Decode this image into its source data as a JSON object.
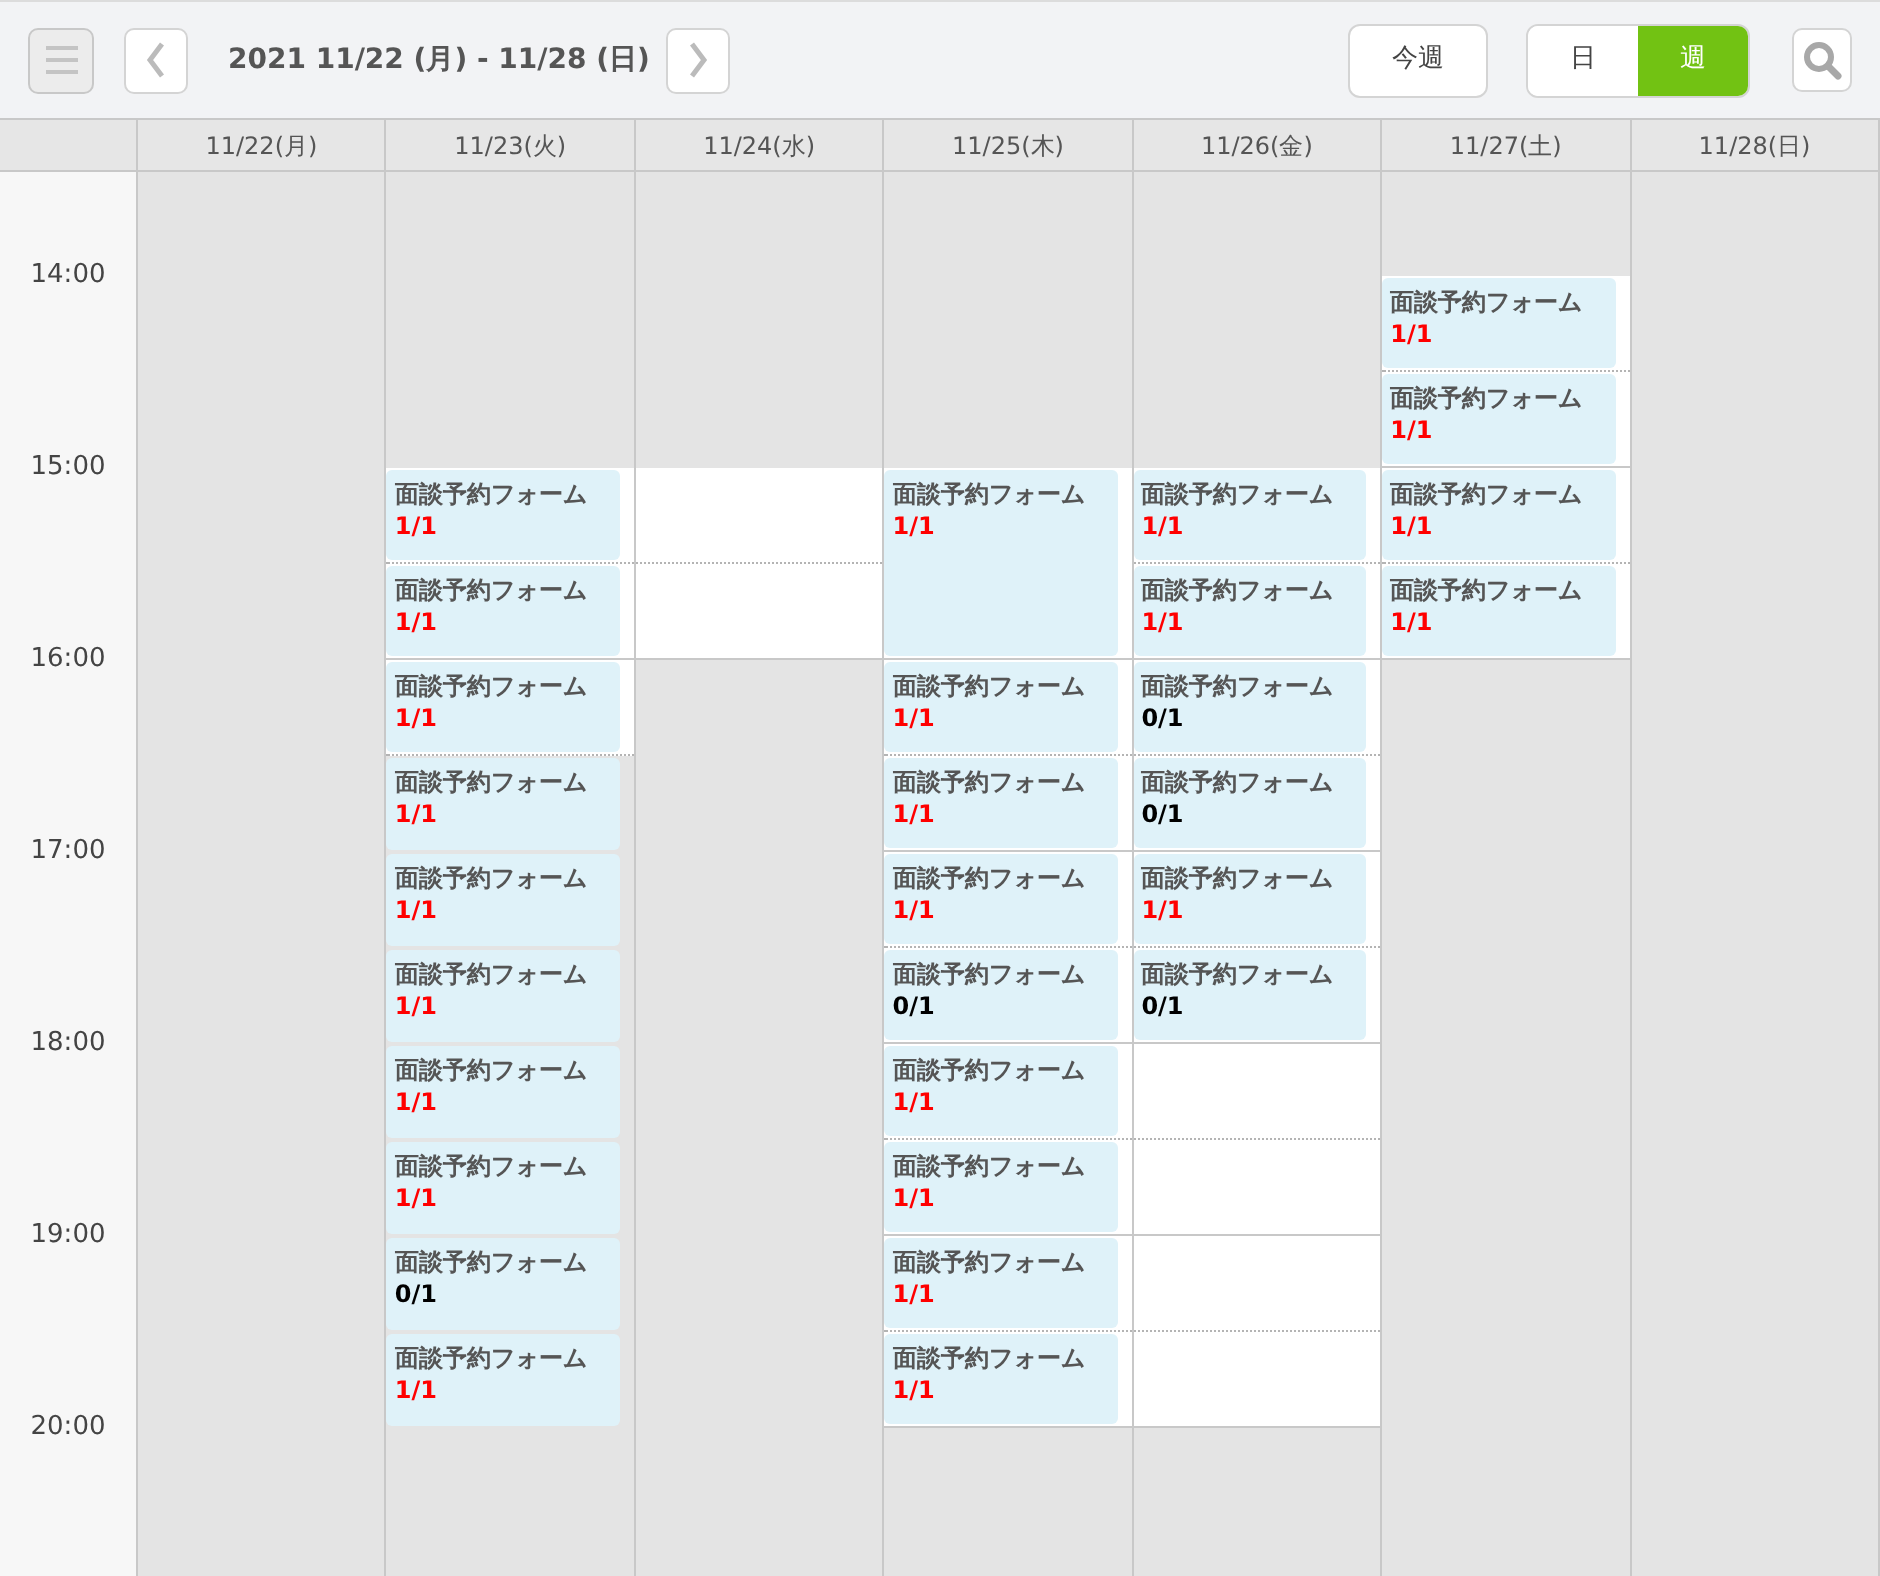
{
  "toolbar": {
    "date_range": "2021 11/22 (月) - 11/28 (日)",
    "today_button": "今週",
    "views": [
      {
        "label": "日",
        "selected": false
      },
      {
        "label": "週",
        "selected": true
      }
    ]
  },
  "times": [
    "14:00",
    "15:00",
    "16:00",
    "17:00",
    "18:00",
    "19:00",
    "20:00"
  ],
  "days": [
    {
      "label": "11/22(月)",
      "slots": [
        {
          "kind": "closed"
        },
        {
          "kind": "closed"
        },
        {
          "kind": "closed"
        },
        {
          "kind": "closed"
        },
        {
          "kind": "closed"
        },
        {
          "kind": "closed"
        },
        {
          "kind": "closed"
        },
        {
          "kind": "closed"
        },
        {
          "kind": "closed"
        },
        {
          "kind": "closed"
        },
        {
          "kind": "closed"
        },
        {
          "kind": "closed"
        },
        {
          "kind": "closed"
        },
        {
          "kind": "closed"
        }
      ]
    },
    {
      "label": "11/23(火)",
      "slots": [
        {
          "kind": "closed"
        },
        {
          "kind": "closed"
        },
        {
          "kind": "event",
          "open": true,
          "title": "面談予約フォーム",
          "count": "1/1",
          "full": true
        },
        {
          "kind": "event",
          "open": true,
          "title": "面談予約フォーム",
          "count": "1/1",
          "full": true
        },
        {
          "kind": "event",
          "open": true,
          "title": "面談予約フォーム",
          "count": "1/1",
          "full": true
        },
        {
          "kind": "event",
          "open": false,
          "title": "面談予約フォーム",
          "count": "1/1",
          "full": true
        },
        {
          "kind": "event",
          "open": false,
          "title": "面談予約フォーム",
          "count": "1/1",
          "full": true
        },
        {
          "kind": "event",
          "open": false,
          "title": "面談予約フォーム",
          "count": "1/1",
          "full": true
        },
        {
          "kind": "event",
          "open": false,
          "title": "面談予約フォーム",
          "count": "1/1",
          "full": true
        },
        {
          "kind": "event",
          "open": false,
          "title": "面談予約フォーム",
          "count": "1/1",
          "full": true
        },
        {
          "kind": "event",
          "open": false,
          "title": "面談予約フォーム",
          "count": "0/1",
          "full": false
        },
        {
          "kind": "event",
          "open": false,
          "title": "面談予約フォーム",
          "count": "1/1",
          "full": true
        },
        {
          "kind": "closed"
        },
        {
          "kind": "closed"
        }
      ]
    },
    {
      "label": "11/24(水)",
      "slots": [
        {
          "kind": "closed"
        },
        {
          "kind": "closed"
        },
        {
          "kind": "open"
        },
        {
          "kind": "open"
        },
        {
          "kind": "closed"
        },
        {
          "kind": "closed"
        },
        {
          "kind": "closed"
        },
        {
          "kind": "closed"
        },
        {
          "kind": "closed"
        },
        {
          "kind": "closed"
        },
        {
          "kind": "closed"
        },
        {
          "kind": "closed"
        },
        {
          "kind": "closed"
        },
        {
          "kind": "closed"
        }
      ]
    },
    {
      "label": "11/25(木)",
      "slots": [
        {
          "kind": "closed"
        },
        {
          "kind": "closed"
        },
        {
          "kind": "event",
          "open": true,
          "title": "面談予約フォーム",
          "count": "1/1",
          "full": true
        },
        {
          "kind": "continued"
        },
        {
          "kind": "event",
          "open": true,
          "title": "面談予約フォーム",
          "count": "1/1",
          "full": true
        },
        {
          "kind": "event",
          "open": true,
          "title": "面談予約フォーム",
          "count": "1/1",
          "full": true
        },
        {
          "kind": "event",
          "open": true,
          "title": "面談予約フォーム",
          "count": "1/1",
          "full": true
        },
        {
          "kind": "event",
          "open": true,
          "title": "面談予約フォーム",
          "count": "0/1",
          "full": false
        },
        {
          "kind": "event",
          "open": true,
          "title": "面談予約フォーム",
          "count": "1/1",
          "full": true
        },
        {
          "kind": "event",
          "open": true,
          "title": "面談予約フォーム",
          "count": "1/1",
          "full": true
        },
        {
          "kind": "event",
          "open": true,
          "title": "面談予約フォーム",
          "count": "1/1",
          "full": true
        },
        {
          "kind": "event",
          "open": true,
          "title": "面談予約フォーム",
          "count": "1/1",
          "full": true
        },
        {
          "kind": "closed"
        },
        {
          "kind": "closed"
        }
      ]
    },
    {
      "label": "11/26(金)",
      "slots": [
        {
          "kind": "closed"
        },
        {
          "kind": "closed"
        },
        {
          "kind": "event",
          "open": true,
          "title": "面談予約フォーム",
          "count": "1/1",
          "full": true
        },
        {
          "kind": "event",
          "open": true,
          "title": "面談予約フォーム",
          "count": "1/1",
          "full": true
        },
        {
          "kind": "event",
          "open": true,
          "title": "面談予約フォーム",
          "count": "0/1",
          "full": false
        },
        {
          "kind": "event",
          "open": true,
          "title": "面談予約フォーム",
          "count": "0/1",
          "full": false
        },
        {
          "kind": "event",
          "open": true,
          "title": "面談予約フォーム",
          "count": "1/1",
          "full": true
        },
        {
          "kind": "event",
          "open": true,
          "title": "面談予約フォーム",
          "count": "0/1",
          "full": false
        },
        {
          "kind": "open"
        },
        {
          "kind": "open"
        },
        {
          "kind": "open"
        },
        {
          "kind": "open"
        },
        {
          "kind": "closed"
        },
        {
          "kind": "closed"
        }
      ]
    },
    {
      "label": "11/27(土)",
      "slots": [
        {
          "kind": "event",
          "open": true,
          "title": "面談予約フォーム",
          "count": "1/1",
          "full": true
        },
        {
          "kind": "event",
          "open": true,
          "title": "面談予約フォーム",
          "count": "1/1",
          "full": true
        },
        {
          "kind": "event",
          "open": true,
          "title": "面談予約フォーム",
          "count": "1/1",
          "full": true
        },
        {
          "kind": "event",
          "open": true,
          "title": "面談予約フォーム",
          "count": "1/1",
          "full": true
        },
        {
          "kind": "closed"
        },
        {
          "kind": "closed"
        },
        {
          "kind": "closed"
        },
        {
          "kind": "closed"
        },
        {
          "kind": "closed"
        },
        {
          "kind": "closed"
        },
        {
          "kind": "closed"
        },
        {
          "kind": "closed"
        },
        {
          "kind": "closed"
        },
        {
          "kind": "closed"
        }
      ]
    },
    {
      "label": "11/28(日)",
      "slots": [
        {
          "kind": "closed"
        },
        {
          "kind": "closed"
        },
        {
          "kind": "closed"
        },
        {
          "kind": "closed"
        },
        {
          "kind": "closed"
        },
        {
          "kind": "closed"
        },
        {
          "kind": "closed"
        },
        {
          "kind": "closed"
        },
        {
          "kind": "closed"
        },
        {
          "kind": "closed"
        },
        {
          "kind": "closed"
        },
        {
          "kind": "closed"
        },
        {
          "kind": "closed"
        },
        {
          "kind": "closed"
        }
      ]
    }
  ]
}
